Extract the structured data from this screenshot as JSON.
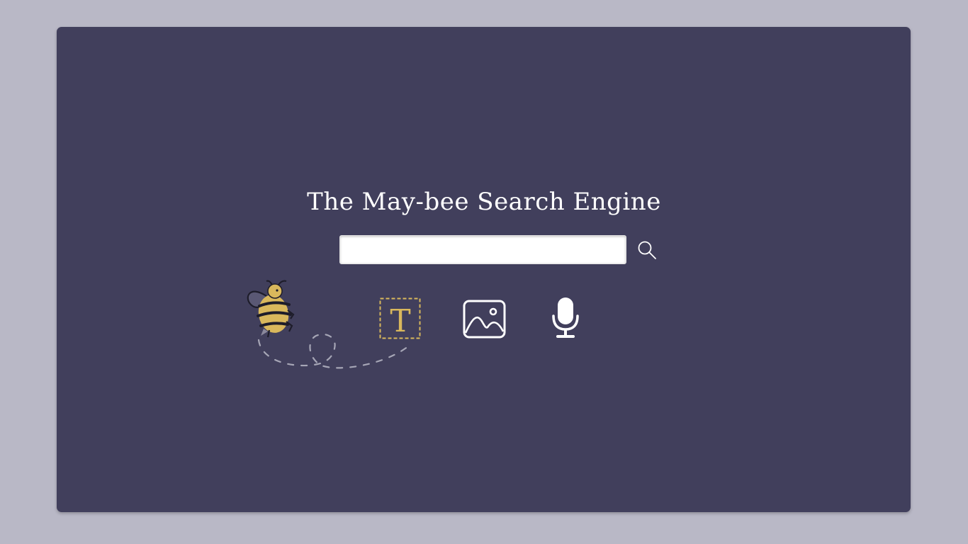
{
  "page": {
    "title": "The May-bee Search Engine"
  },
  "search": {
    "value": "",
    "placeholder": "",
    "button_icon": "search-icon"
  },
  "modes": [
    {
      "name": "text-search",
      "icon": "text-icon",
      "active": true
    },
    {
      "name": "image-search",
      "icon": "image-icon",
      "active": false
    },
    {
      "name": "voice-search",
      "icon": "microphone-icon",
      "active": false
    }
  ],
  "colors": {
    "page_background": "#b9b8c6",
    "card_background": "#413f5c",
    "accent": "#d9b85c",
    "text": "#ffffff"
  }
}
